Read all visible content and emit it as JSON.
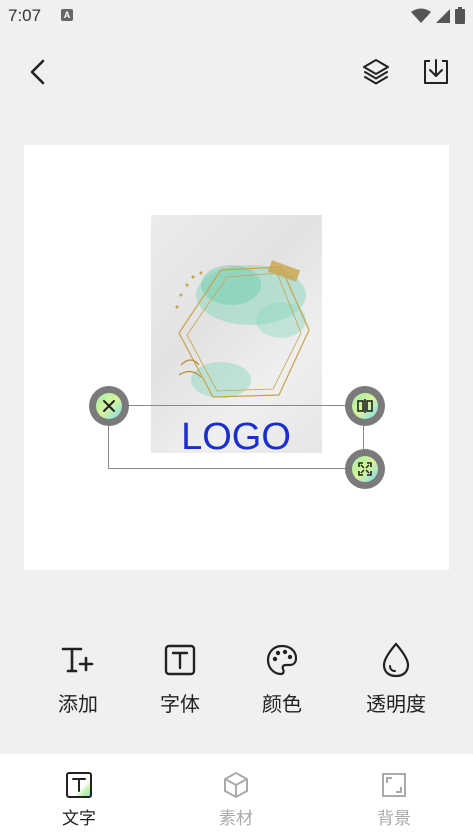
{
  "status_bar": {
    "time": "7:07",
    "notification_badge": "A"
  },
  "toolbar": {
    "back_icon": "chevron-left-icon",
    "layers_icon": "layers-icon",
    "download_icon": "download-icon"
  },
  "canvas": {
    "logo_text": "LOGO",
    "logo_color": "#1a2fcc"
  },
  "tools": [
    {
      "label": "添加",
      "icon": "text-add-icon"
    },
    {
      "label": "字体",
      "icon": "font-box-icon"
    },
    {
      "label": "颜色",
      "icon": "palette-icon"
    },
    {
      "label": "透明度",
      "icon": "opacity-drop-icon"
    }
  ],
  "bottom_nav": [
    {
      "label": "文字",
      "icon": "text-tab-icon",
      "active": true
    },
    {
      "label": "素材",
      "icon": "cube-icon",
      "active": false
    },
    {
      "label": "背景",
      "icon": "background-icon",
      "active": false
    }
  ]
}
